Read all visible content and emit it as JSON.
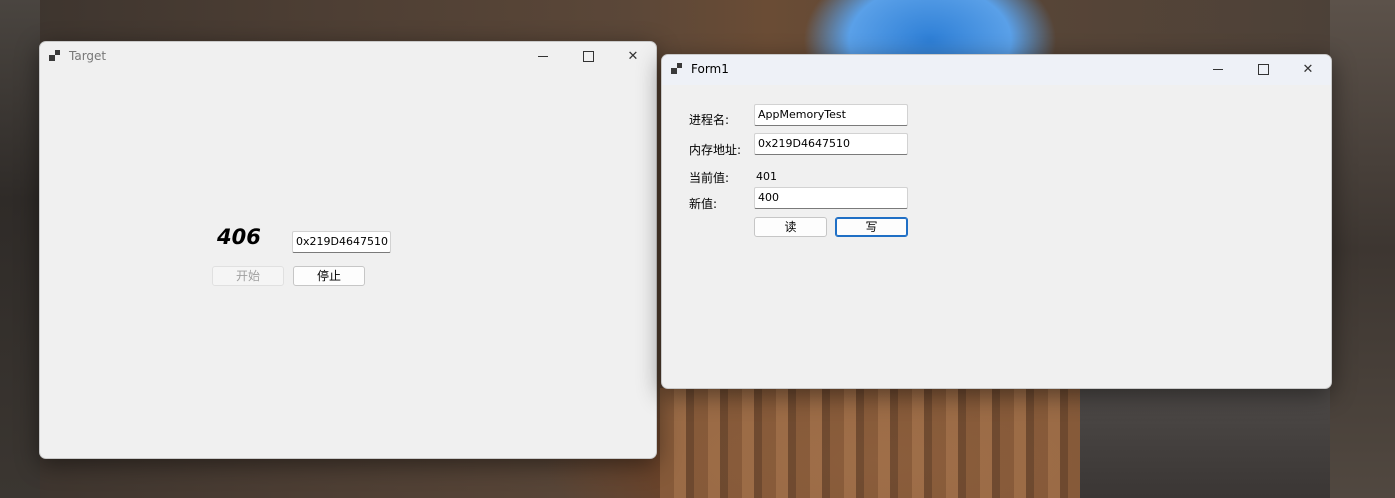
{
  "target_window": {
    "title": "Target",
    "counter": "406",
    "address_field": "0x219D4647510",
    "start_button": "开始",
    "stop_button": "停止"
  },
  "form1_window": {
    "title": "Form1",
    "process_label": "进程名:",
    "process_value": "AppMemoryTest",
    "address_label": "内存地址:",
    "address_value": "0x219D4647510",
    "current_label": "当前值:",
    "current_value": "401",
    "new_label": "新值:",
    "new_value": "400",
    "read_button": "读",
    "write_button": "写"
  },
  "window_controls": {
    "close_glyph": "✕"
  }
}
